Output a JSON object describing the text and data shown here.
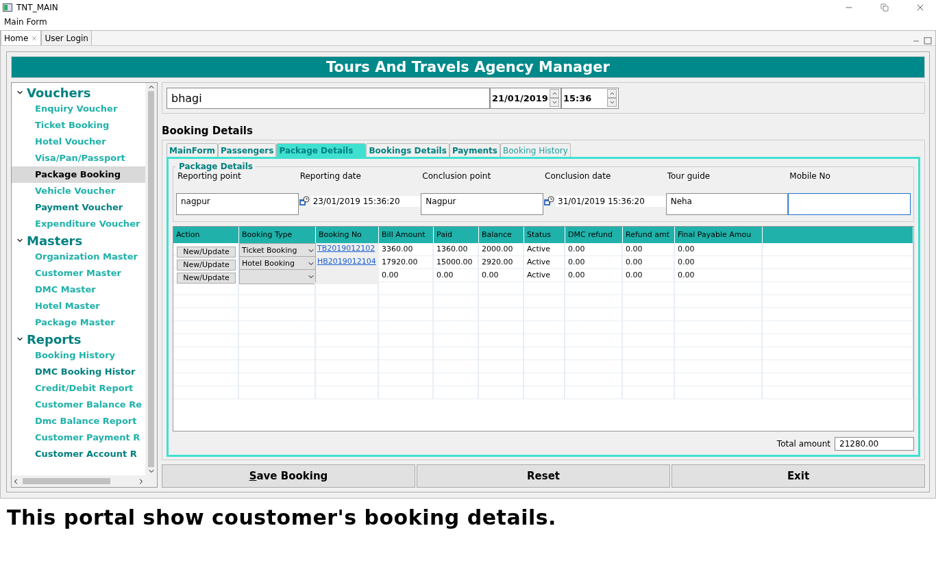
{
  "window": {
    "title": "TNT_MAIN"
  },
  "menu": [
    "Main Form"
  ],
  "tabs": [
    {
      "label": "Home",
      "selected": true,
      "closable": true
    },
    {
      "label": "User Login",
      "selected": false,
      "closable": false
    }
  ],
  "banner": "Tours And Travels Agency Manager",
  "sidebar": {
    "groups": [
      {
        "label": "Vouchers",
        "expanded": true,
        "children": [
          {
            "label": "Enquiry Voucher",
            "selected": false,
            "color": "#20b2aa"
          },
          {
            "label": "Ticket Booking",
            "selected": false,
            "color": "#20b2aa"
          },
          {
            "label": "Hotel Voucher",
            "selected": false,
            "color": "#20b2aa"
          },
          {
            "label": "Visa/Pan/Passport",
            "selected": false,
            "color": "#20b2aa"
          },
          {
            "label": "Package Booking",
            "selected": true
          },
          {
            "label": "Vehicle Voucher",
            "selected": false,
            "color": "#20b2aa"
          },
          {
            "label": "Payment Voucher",
            "selected": false,
            "color": "#008080"
          },
          {
            "label": "Expenditure Voucher",
            "selected": false,
            "color": "#20b2aa"
          }
        ]
      },
      {
        "label": "Masters",
        "expanded": true,
        "children": [
          {
            "label": "Organization Master",
            "selected": false,
            "color": "#20b2aa"
          },
          {
            "label": "Customer Master",
            "selected": false,
            "color": "#20b2aa"
          },
          {
            "label": "DMC Master",
            "selected": false,
            "color": "#20b2aa"
          },
          {
            "label": "Hotel Master",
            "selected": false,
            "color": "#20b2aa"
          },
          {
            "label": "Package Master",
            "selected": false,
            "color": "#20b2aa"
          }
        ]
      },
      {
        "label": "Reports",
        "expanded": true,
        "children": [
          {
            "label": "Booking History",
            "selected": false,
            "color": "#20b2aa"
          },
          {
            "label": "DMC Booking Histor",
            "selected": false,
            "color": "#008080"
          },
          {
            "label": "Credit/Debit Report",
            "selected": false,
            "color": "#20b2aa"
          },
          {
            "label": "Customer Balance Re",
            "selected": false,
            "color": "#20b2aa"
          },
          {
            "label": "Dmc Balance Report",
            "selected": false,
            "color": "#20b2aa"
          },
          {
            "label": "Customer Payment R",
            "selected": false,
            "color": "#20b2aa"
          },
          {
            "label": "Customer Account R",
            "selected": false,
            "color": "#008080"
          }
        ]
      }
    ]
  },
  "customer": {
    "value": "bhagi",
    "date": "21/01/2019",
    "time": "15:36"
  },
  "booking_details": {
    "title": "Booking Details",
    "tabs": [
      {
        "label": "MainForm",
        "selected": false,
        "disabled": false
      },
      {
        "label": "Passengers",
        "selected": false,
        "disabled": false
      },
      {
        "label": "Package Details",
        "selected": true,
        "disabled": false
      },
      {
        "label": "Bookings Details",
        "selected": false,
        "disabled": false
      },
      {
        "label": "Payments",
        "selected": false,
        "disabled": false
      },
      {
        "label": "Booking History",
        "selected": false,
        "disabled": true
      }
    ],
    "package": {
      "title": "Package Details",
      "fields": [
        {
          "label": "Reporting point",
          "value": "nagpur",
          "kind": "text",
          "focused": false
        },
        {
          "label": "Reporting date",
          "value": "23/01/2019 15:36:20",
          "kind": "datetime"
        },
        {
          "label": "Conclusion point",
          "value": "Nagpur",
          "kind": "text",
          "focused": false
        },
        {
          "label": "Conclusion date",
          "value": "31/01/2019 15:36:20",
          "kind": "datetime"
        },
        {
          "label": "Tour guide",
          "value": "Neha",
          "kind": "text",
          "focused": false
        },
        {
          "label": "Mobile No",
          "kind": "text",
          "focused": true
        }
      ]
    },
    "table": {
      "columns": [
        "Action",
        "Booking Type",
        "Booking No",
        "Bill Amount",
        "Paid",
        "Balance",
        "Status",
        "DMC refund",
        "Refund amt",
        "Final Payable Amou"
      ],
      "rows": [
        {
          "action": "New/Update",
          "booking_type": "Ticket Booking",
          "booking_no": "TB2019012102",
          "bill_amount": "3360.00",
          "paid": "1360.00",
          "balance": "2000.00",
          "status": "Active",
          "dmc_refund": "0.00",
          "refund_amt": "0.00",
          "final_payable": "0.00"
        },
        {
          "action": "New/Update",
          "booking_type": "Hotel Booking",
          "booking_no": "HB2019012104",
          "bill_amount": "17920.00",
          "paid": "15000.00",
          "balance": "2920.00",
          "status": "Active",
          "dmc_refund": "0.00",
          "refund_amt": "0.00",
          "final_payable": "0.00"
        },
        {
          "action": "New/Update",
          "bill_amount": "0.00",
          "paid": "0.00",
          "balance": "0.00",
          "status": "Active",
          "dmc_refund": "0.00",
          "refund_amt": "0.00",
          "final_payable": "0.00"
        }
      ]
    },
    "total": {
      "label": "Total amount",
      "value": "21280.00"
    }
  },
  "buttons": [
    {
      "label": "Save Booking",
      "mnemonic": true
    },
    {
      "label": "Reset",
      "mnemonic": false
    },
    {
      "label": "Exit",
      "mnemonic": false
    }
  ],
  "caption": "This portal show coustomer's booking details."
}
